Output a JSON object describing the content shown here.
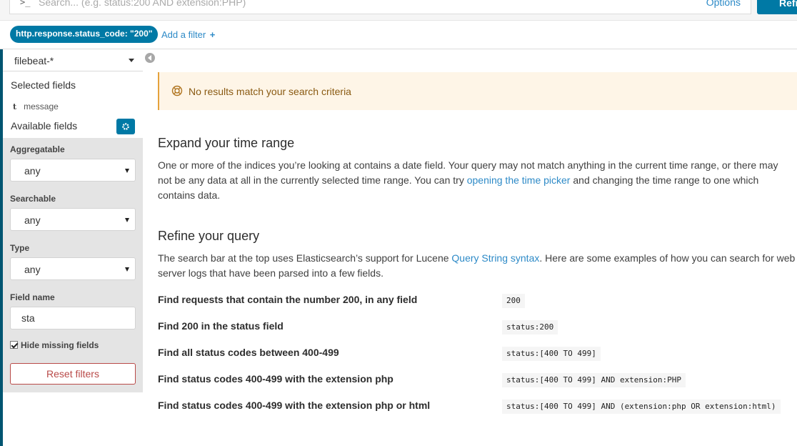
{
  "query_bar": {
    "prompt_symbol": ">_",
    "search_placeholder": "Search... (e.g. status:200 AND extension:PHP)",
    "options_label": "Options",
    "refresh_label": "Refresh"
  },
  "filters": {
    "active_filter": "http.response.status_code: \"200\"",
    "add_filter_label": "Add a filter",
    "add_filter_plus": "+"
  },
  "sidebar": {
    "index_pattern": "filebeat-*",
    "selected_fields_title": "Selected fields",
    "selected_fields": [
      {
        "type": "t",
        "name": "message"
      }
    ],
    "available_fields_title": "Available fields",
    "field_filter": {
      "aggregatable_label": "Aggregatable",
      "aggregatable_value": "any",
      "searchable_label": "Searchable",
      "searchable_value": "any",
      "type_label": "Type",
      "type_value": "any",
      "field_name_label": "Field name",
      "field_name_value": "sta",
      "hide_missing_label": "Hide missing fields",
      "hide_missing_checked": true,
      "reset_label": "Reset filters"
    }
  },
  "main": {
    "no_results": "No results match your search criteria",
    "expand_title": "Expand your time range",
    "expand_p1": "One or more of the indices you’re looking at contains a date field. Your query may not match anything in the current time range, or there may",
    "expand_p2_pre": "not be any data at all in the currently selected time range. You can try ",
    "expand_link": "opening the time picker",
    "expand_p2_post": " and changing the time range to one which",
    "expand_p3": "contains data.",
    "refine_title": "Refine your query",
    "refine_p1_pre": "The search bar at the top uses Elasticsearch’s support for Lucene ",
    "refine_link": "Query String syntax",
    "refine_p1_post": ". Here are some examples of how you can search for web",
    "refine_p2": "server logs that have been parsed into a few fields.",
    "examples": [
      {
        "label": "Find requests that contain the number 200, in any field",
        "code": "200"
      },
      {
        "label": "Find 200 in the status field",
        "code": "status:200"
      },
      {
        "label": "Find all status codes between 400-499",
        "code": "status:[400 TO 499]"
      },
      {
        "label": "Find status codes 400-499 with the extension php",
        "code": "status:[400 TO 499] AND extension:PHP"
      },
      {
        "label": "Find status codes 400-499 with the extension php or html",
        "code": "status:[400 TO 499] AND (extension:php OR extension:html)"
      }
    ]
  },
  "colors": {
    "accent": "#0079a5",
    "link": "#2d8ac7",
    "warning_bg": "#fef5e7",
    "danger": "#b94a48"
  }
}
